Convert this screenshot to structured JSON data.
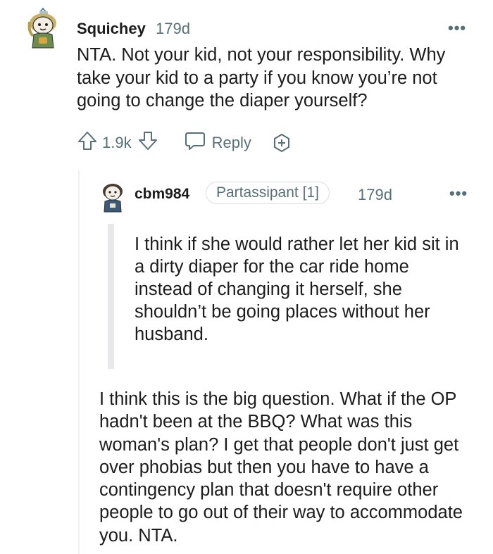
{
  "comment": {
    "username": "Squichey",
    "time": "179d",
    "body": "NTA. Not your kid, not your responsibility. Why take your kid to a party if you know you’re not going to change the diaper yourself?",
    "score": "1.9k",
    "reply_label": "Reply",
    "more_label": "•••"
  },
  "reply": {
    "username": "cbm984",
    "flair": "Partassipant [1]",
    "time": "179d",
    "more_label": "•••",
    "quote": "I think if she would rather let her kid sit in a dirty diaper for the car ride home instead of changing it herself, she shouldn’t be going places without her husband.",
    "body": "I think this is the big question. What if the OP hadn't been at the BBQ? What was this woman's plan? I get that people don't just get over phobias but then you have to have a contingency plan that doesn't require other people to go out of their way to accommodate you. NTA."
  },
  "colors": {
    "text": "#1c1c1c",
    "meta": "#576f76",
    "quote_bar": "#e7e8ea",
    "thread_line": "#edeff1"
  },
  "icons": [
    "avatar",
    "upvote-icon",
    "downvote-icon",
    "reply-icon",
    "award-icon",
    "more-options-icon"
  ]
}
